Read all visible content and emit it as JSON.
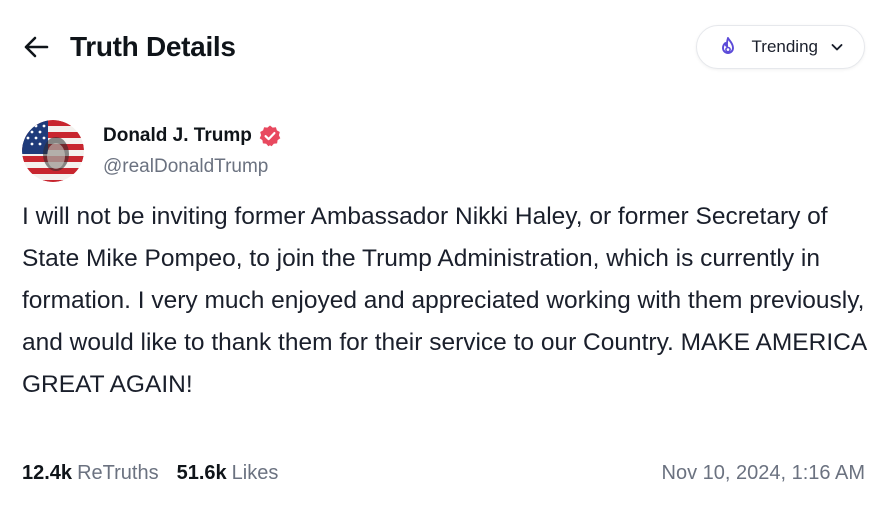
{
  "header": {
    "title": "Truth Details",
    "back_icon": "arrow-left-icon",
    "feed_selector": {
      "label": "Trending",
      "icon": "flame-icon",
      "icon_color": "#5b4ad8",
      "chevron": "chevron-down-icon"
    }
  },
  "post": {
    "author": {
      "display_name": "Donald J. Trump",
      "handle": "@realDonaldTrump",
      "verified_icon": "verified-badge-icon",
      "verified_color": "#e8495f"
    },
    "text": "I will not be inviting former Ambassador Nikki Haley, or former Secretary of State Mike Pompeo, to join the Trump Administration, which is currently in formation. I very much enjoyed and appreciated working with them previously, and would like to thank them for their service to our Country. MAKE AMERICA GREAT AGAIN!",
    "stats": {
      "retruths_count": "12.4k",
      "retruths_label": "ReTruths",
      "likes_count": "51.6k",
      "likes_label": "Likes"
    },
    "timestamp": "Nov 10, 2024, 1:16 AM"
  }
}
